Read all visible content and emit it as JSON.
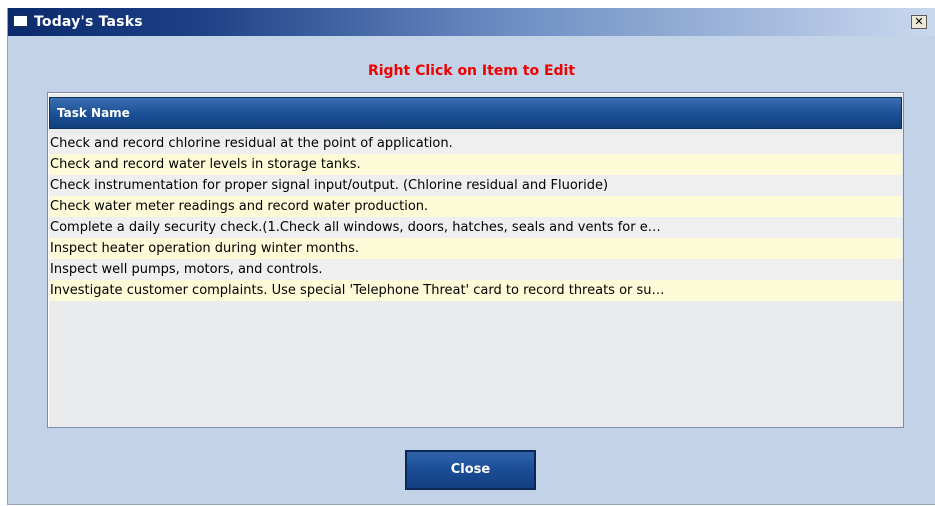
{
  "window": {
    "title": "Today's Tasks",
    "close_glyph": "✕"
  },
  "instruction": "Right Click on Item to Edit",
  "grid": {
    "column_header": "Task Name",
    "rows": [
      "Check and record chlorine residual at the point of application.",
      "Check and record water levels in storage tanks.",
      "Check instrumentation for proper signal input/output. (Chlorine residual and Fluoride)",
      "Check water meter readings and record water production.",
      "Complete a daily security check.(1.Check all windows, doors, hatches, seals and vents for e…",
      "Inspect heater operation during winter months.",
      "Inspect well pumps, motors, and controls.",
      "Investigate customer complaints. Use special 'Telephone Threat' card to record threats or su…"
    ]
  },
  "buttons": {
    "close_label": "Close"
  },
  "colors": {
    "instruction_text": "#ee0000",
    "row_even": "#efefef",
    "row_odd": "#fdfbd7",
    "header_blue": "#1a4f96"
  }
}
